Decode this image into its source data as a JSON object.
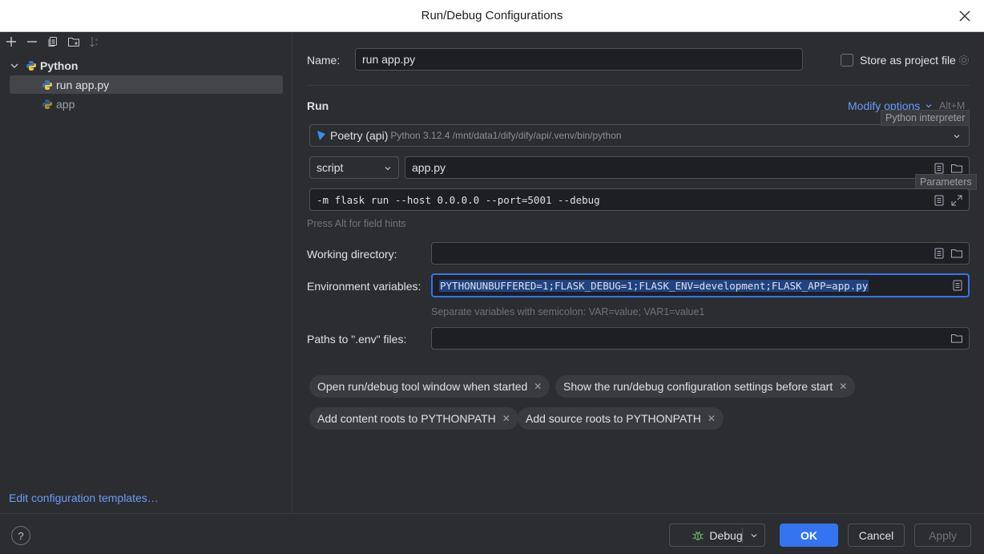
{
  "window": {
    "title": "Run/Debug Configurations"
  },
  "tree": {
    "group_label": "Python",
    "items": [
      {
        "label": "run app.py",
        "selected": true
      },
      {
        "label": "app",
        "selected": false
      }
    ],
    "edit_templates_label": "Edit configuration templates…"
  },
  "form": {
    "name_label": "Name:",
    "name_value": "run app.py",
    "store_label": "Store as project file",
    "run_heading": "Run",
    "modify_options_label": "Modify options",
    "modify_shortcut": "Alt+M",
    "interpreter_tooltip": "Python interpreter",
    "interpreter_name": "Poetry (api)",
    "interpreter_detail": "Python 3.12.4 /mnt/data1/dify/dify/api/.venv/bin/python",
    "script_mode": "script",
    "script_value": "app.py",
    "parameters_tooltip": "Parameters",
    "parameters_value": "-m flask run --host 0.0.0.0 --port=5001 --debug",
    "field_hint": "Press Alt for field hints",
    "workdir_label": "Working directory:",
    "workdir_value": "",
    "env_label": "Environment variables:",
    "env_value": "PYTHONUNBUFFERED=1;FLASK_DEBUG=1;FLASK_ENV=development;FLASK_APP=app.py",
    "env_hint": "Separate variables with semicolon: VAR=value; VAR1=value1",
    "dotenv_label": "Paths to \".env\" files:",
    "dotenv_value": ""
  },
  "chips": [
    "Open run/debug tool window when started",
    "Show the run/debug configuration settings before start",
    "Add content roots to PYTHONPATH",
    "Add source roots to PYTHONPATH"
  ],
  "footer": {
    "help_label": "?",
    "debug_label": "Debug",
    "ok_label": "OK",
    "cancel_label": "Cancel",
    "apply_label": "Apply"
  },
  "colors": {
    "accent": "#3574f0",
    "link": "#6b9bfa",
    "background": "#2b2d30"
  }
}
